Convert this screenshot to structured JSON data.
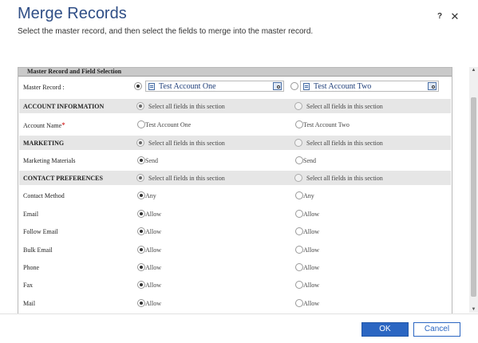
{
  "dialog": {
    "title": "Merge Records",
    "subtitle": "Select the master record, and then select the fields to merge into the master record.",
    "help_label": "?",
    "close_label": "✕"
  },
  "panel": {
    "header": "Master Record and Field Selection"
  },
  "master": {
    "label": "Master Record :",
    "record1": "Test Account One",
    "record2": "Test Account Two"
  },
  "sections": {
    "account": "ACCOUNT INFORMATION",
    "marketing": "MARKETING",
    "contact": "CONTACT PREFERENCES",
    "select_all": "Select all fields in this section"
  },
  "fields": {
    "account_name": {
      "label": "Account Name",
      "required": "*",
      "v1": "Test Account One",
      "v2": "Test Account Two"
    },
    "marketing_materials": {
      "label": "Marketing Materials",
      "v1": "Send",
      "v2": "Send"
    },
    "contact_method": {
      "label": "Contact Method",
      "v1": "Any",
      "v2": "Any"
    },
    "email": {
      "label": "Email",
      "v1": "Allow",
      "v2": "Allow"
    },
    "follow_email": {
      "label": "Follow Email",
      "v1": "Allow",
      "v2": "Allow"
    },
    "bulk_email": {
      "label": "Bulk Email",
      "v1": "Allow",
      "v2": "Allow"
    },
    "phone": {
      "label": "Phone",
      "v1": "Allow",
      "v2": "Allow"
    },
    "fax": {
      "label": "Fax",
      "v1": "Allow",
      "v2": "Allow"
    },
    "mail": {
      "label": "Mail",
      "v1": "Allow",
      "v2": "Allow"
    }
  },
  "footer": {
    "ok_label": "OK",
    "cancel_label": "Cancel"
  },
  "colors": {
    "accent": "#2b66c2",
    "title": "#2f4e86",
    "section_bg": "#e6e6e6"
  }
}
